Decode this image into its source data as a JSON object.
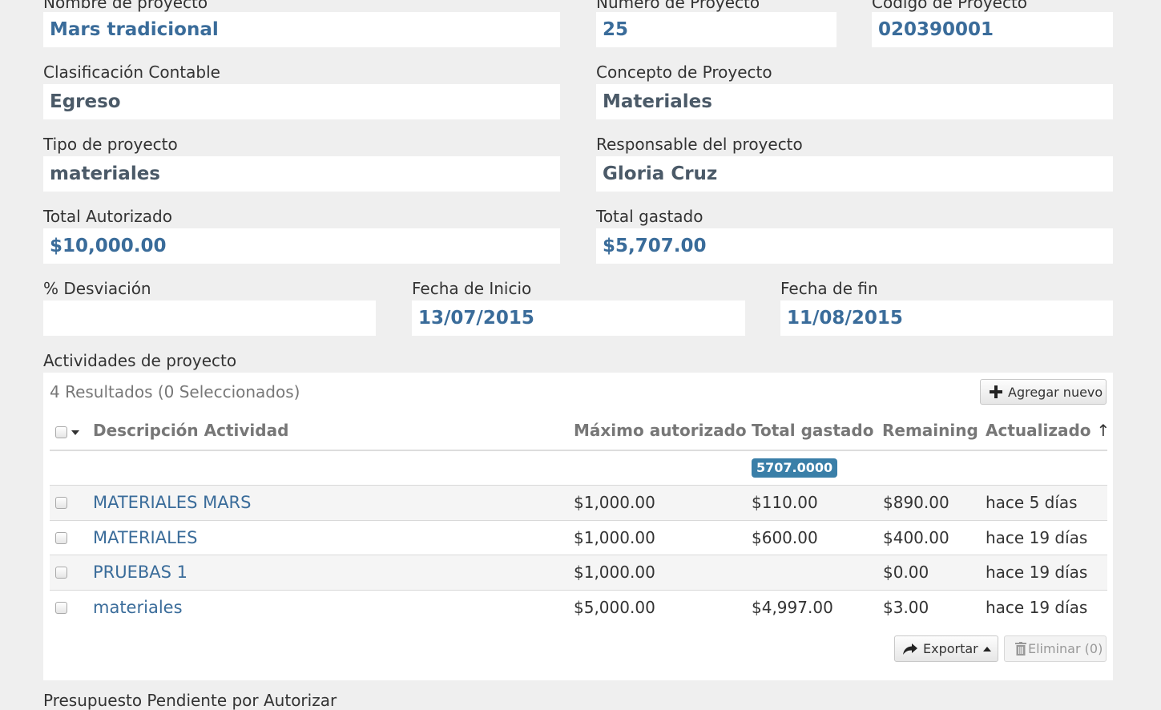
{
  "form": {
    "nombre_label": "Nombre de proyecto",
    "nombre_value": "Mars tradicional",
    "numero_label": "Número de Proyecto",
    "numero_value": "25",
    "codigo_label": "Código de Proyecto",
    "codigo_value": "020390001",
    "clasificacion_label": "Clasificación Contable",
    "clasificacion_value": "Egreso",
    "concepto_label": "Concepto de Proyecto",
    "concepto_value": "Materiales",
    "tipo_label": "Tipo de proyecto",
    "tipo_value": "materiales",
    "responsable_label": "Responsable del proyecto",
    "responsable_value": "Gloria Cruz",
    "total_autorizado_label": "Total Autorizado",
    "total_autorizado_value": "$10,000.00",
    "total_gastado_label": "Total gastado",
    "total_gastado_value": "$5,707.00",
    "desviacion_label": "% Desviación",
    "desviacion_value": "",
    "fecha_inicio_label": "Fecha de Inicio",
    "fecha_inicio_value": "13/07/2015",
    "fecha_fin_label": "Fecha de fin",
    "fecha_fin_value": "11/08/2015"
  },
  "activities": {
    "section_label": "Actividades de proyecto",
    "results_text": "4 Resultados (0 Seleccionados)",
    "add_button": "Agregar nuevo",
    "columns": {
      "descripcion": "Descripción Actividad",
      "maximo": "Máximo autorizado",
      "gastado": "Total gastado",
      "remaining": "Remaining",
      "actualizado": "Actualizado"
    },
    "sort_indicator": "↑",
    "total_badge": "5707.0000",
    "rows": [
      {
        "descripcion": "MATERIALES MARS",
        "maximo": "$1,000.00",
        "gastado": "$110.00",
        "remaining": "$890.00",
        "actualizado": "hace 5 días"
      },
      {
        "descripcion": "MATERIALES",
        "maximo": "$1,000.00",
        "gastado": "$600.00",
        "remaining": "$400.00",
        "actualizado": "hace 19 días"
      },
      {
        "descripcion": "PRUEBAS 1",
        "maximo": "$1,000.00",
        "gastado": "",
        "remaining": "$0.00",
        "actualizado": "hace 19 días"
      },
      {
        "descripcion": "materiales",
        "maximo": "$5,000.00",
        "gastado": "$4,997.00",
        "remaining": "$3.00",
        "actualizado": "hace 19 días"
      }
    ],
    "export_button": "Exportar",
    "delete_button": "Eliminar (0)"
  },
  "footer_label": "Presupuesto Pendiente por Autorizar",
  "colors": {
    "background": "#efefef",
    "link_blue": "#3a6c9a",
    "badge": "#3a7fa8"
  },
  "icons": [
    "plus-icon",
    "share-arrow-icon",
    "caret-up-icon",
    "trash-icon",
    "caret-down-icon"
  ]
}
